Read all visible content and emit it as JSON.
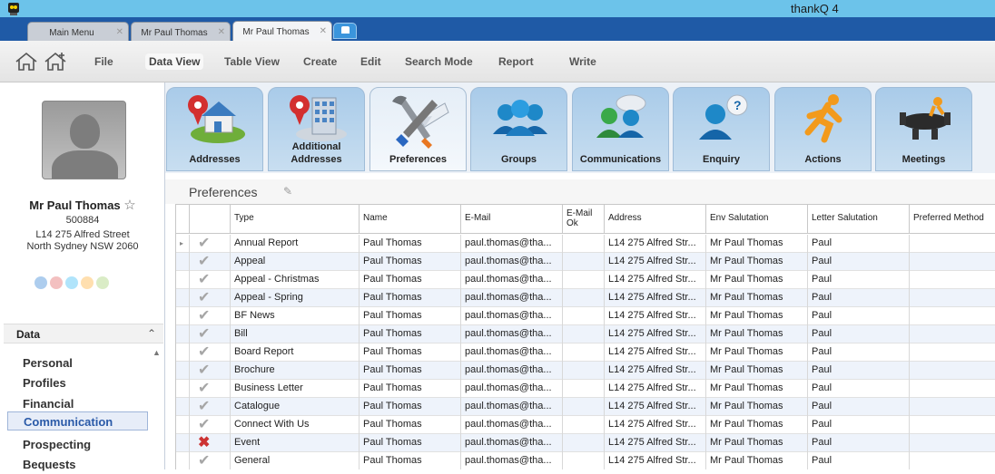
{
  "window": {
    "title": "thankQ 4"
  },
  "doc_tabs": [
    {
      "label": "Main Menu"
    },
    {
      "label": "Mr Paul Thomas"
    },
    {
      "label": "Mr Paul Thomas"
    }
  ],
  "menu": [
    "File",
    "Data View",
    "Table View",
    "Create",
    "Edit",
    "Search Mode",
    "Report",
    "Write"
  ],
  "contact": {
    "name": "Mr Paul Thomas",
    "id": "500884",
    "address_line1": "L14 275 Alfred Street",
    "address_line2": "North Sydney NSW 2060"
  },
  "nav": {
    "header": "Data",
    "items": [
      "Personal",
      "Profiles",
      "Financial",
      "Communication",
      "Prospecting",
      "Bequests"
    ],
    "selected": "Communication"
  },
  "ribbon": [
    {
      "label": "Addresses",
      "icon": "house-pin-icon"
    },
    {
      "label": "Additional Addresses",
      "icon": "building-pin-icon"
    },
    {
      "label": "Preferences",
      "icon": "tools-icon"
    },
    {
      "label": "Groups",
      "icon": "group-icon"
    },
    {
      "label": "Communications",
      "icon": "chat-people-icon"
    },
    {
      "label": "Enquiry",
      "icon": "question-person-icon"
    },
    {
      "label": "Actions",
      "icon": "running-man-icon"
    },
    {
      "label": "Meetings",
      "icon": "meeting-table-icon"
    }
  ],
  "section": {
    "title": "Preferences"
  },
  "table": {
    "columns": [
      "Type",
      "Name",
      "E-Mail",
      "E-Mail Ok",
      "Address",
      "Env Salutation",
      "Letter Salutation",
      "Preferred Method"
    ],
    "rows": [
      {
        "status": "ok",
        "type": "Annual Report",
        "name": "Paul Thomas",
        "email": "paul.thomas@tha...",
        "email_ok": "",
        "address": "L14 275 Alfred Str...",
        "env": "Mr Paul Thomas",
        "letter": "Paul",
        "method": ""
      },
      {
        "status": "ok",
        "type": "Appeal",
        "name": "Paul Thomas",
        "email": "paul.thomas@tha...",
        "email_ok": "",
        "address": "L14 275 Alfred Str...",
        "env": "Mr Paul Thomas",
        "letter": "Paul",
        "method": ""
      },
      {
        "status": "ok",
        "type": "Appeal - Christmas",
        "name": "Paul Thomas",
        "email": "paul.thomas@tha...",
        "email_ok": "",
        "address": "L14 275 Alfred Str...",
        "env": "Mr Paul Thomas",
        "letter": "Paul",
        "method": ""
      },
      {
        "status": "ok",
        "type": "Appeal - Spring",
        "name": "Paul Thomas",
        "email": "paul.thomas@tha...",
        "email_ok": "",
        "address": "L14 275 Alfred Str...",
        "env": "Mr Paul Thomas",
        "letter": "Paul",
        "method": ""
      },
      {
        "status": "ok",
        "type": "BF News",
        "name": "Paul Thomas",
        "email": "paul.thomas@tha...",
        "email_ok": "",
        "address": "L14 275 Alfred Str...",
        "env": "Mr Paul Thomas",
        "letter": "Paul",
        "method": ""
      },
      {
        "status": "ok",
        "type": "Bill",
        "name": "Paul Thomas",
        "email": "paul.thomas@tha...",
        "email_ok": "",
        "address": "L14 275 Alfred Str...",
        "env": "Mr Paul Thomas",
        "letter": "Paul",
        "method": ""
      },
      {
        "status": "ok",
        "type": "Board Report",
        "name": "Paul Thomas",
        "email": "paul.thomas@tha...",
        "email_ok": "",
        "address": "L14 275 Alfred Str...",
        "env": "Mr Paul Thomas",
        "letter": "Paul",
        "method": ""
      },
      {
        "status": "ok",
        "type": "Brochure",
        "name": "Paul Thomas",
        "email": "paul.thomas@tha...",
        "email_ok": "",
        "address": "L14 275 Alfred Str...",
        "env": "Mr Paul Thomas",
        "letter": "Paul",
        "method": ""
      },
      {
        "status": "ok",
        "type": "Business Letter",
        "name": "Paul Thomas",
        "email": "paul.thomas@tha...",
        "email_ok": "",
        "address": "L14 275 Alfred Str...",
        "env": "Mr Paul Thomas",
        "letter": "Paul",
        "method": ""
      },
      {
        "status": "ok",
        "type": "Catalogue",
        "name": "Paul Thomas",
        "email": "paul.thomas@tha...",
        "email_ok": "",
        "address": "L14 275 Alfred Str...",
        "env": "Mr Paul Thomas",
        "letter": "Paul",
        "method": ""
      },
      {
        "status": "ok",
        "type": "Connect With Us",
        "name": "Paul Thomas",
        "email": "paul.thomas@tha...",
        "email_ok": "",
        "address": "L14 275 Alfred Str...",
        "env": "Mr Paul Thomas",
        "letter": "Paul",
        "method": ""
      },
      {
        "status": "bad",
        "type": "Event",
        "name": "Paul Thomas",
        "email": "paul.thomas@tha...",
        "email_ok": "",
        "address": "L14 275 Alfred Str...",
        "env": "Mr Paul Thomas",
        "letter": "Paul",
        "method": ""
      },
      {
        "status": "ok",
        "type": "General",
        "name": "Paul Thomas",
        "email": "paul.thomas@tha...",
        "email_ok": "",
        "address": "L14 275 Alfred Str...",
        "env": "Mr Paul Thomas",
        "letter": "Paul",
        "method": ""
      }
    ]
  }
}
